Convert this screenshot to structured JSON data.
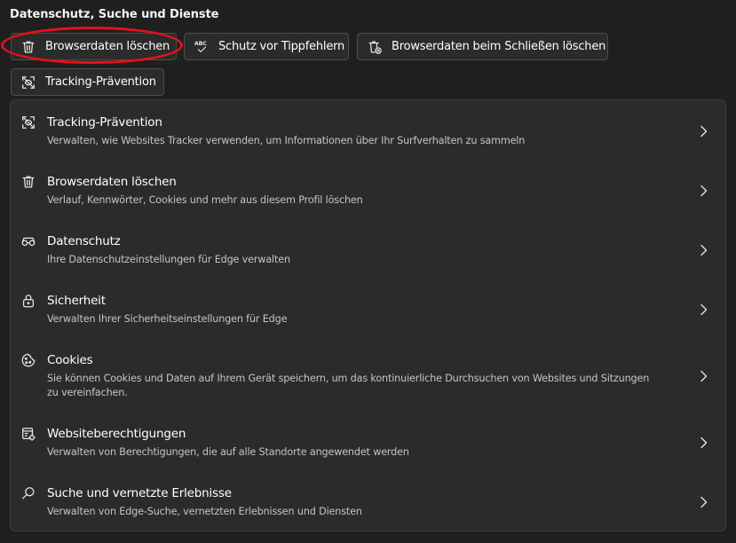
{
  "section": {
    "title": "Datenschutz, Suche und Dienste"
  },
  "chips": [
    {
      "label": "Browserdaten löschen",
      "icon": "trash-icon"
    },
    {
      "label": "Schutz vor Tippfehlern",
      "icon": "spellcheck-icon"
    },
    {
      "label": "Browserdaten beim Schließen löschen",
      "icon": "trash-clock-icon"
    },
    {
      "label": "Tracking-Prävention",
      "icon": "tracking-icon"
    }
  ],
  "highlight": {
    "color": "#e8101b",
    "target": "Browserdaten löschen"
  },
  "settings": [
    {
      "title": "Tracking-Prävention",
      "description": "Verwalten, wie Websites Tracker verwenden, um Informationen über Ihr Surfverhalten zu sammeln",
      "icon": "tracking-icon"
    },
    {
      "title": "Browserdaten löschen",
      "description": "Verlauf, Kennwörter, Cookies und mehr aus diesem Profil löschen",
      "icon": "trash-icon"
    },
    {
      "title": "Datenschutz",
      "description": "Ihre Datenschutzeinstellungen für Edge verwalten",
      "icon": "glasses-icon"
    },
    {
      "title": "Sicherheit",
      "description": "Verwalten Ihrer Sicherheitseinstellungen für Edge",
      "icon": "lock-icon"
    },
    {
      "title": "Cookies",
      "description": "Sie können Cookies und Daten auf Ihrem Gerät speichern, um das kontinuierliche Durchsuchen von Websites und Sitzungen zu vereinfachen.",
      "icon": "cookie-icon"
    },
    {
      "title": "Websiteberechtigungen",
      "description": "Verwalten von Berechtigungen, die auf alle Standorte angewendet werden",
      "icon": "site-permissions-icon"
    },
    {
      "title": "Suche und vernetzte Erlebnisse",
      "description": "Verwalten von Edge-Suche, vernetzten Erlebnissen und Diensten",
      "icon": "search-icon"
    }
  ],
  "colors": {
    "background": "#1f1f1f",
    "card": "#2b2b2b",
    "text": "#ffffff",
    "secondary_text": "#c5c5c5"
  }
}
